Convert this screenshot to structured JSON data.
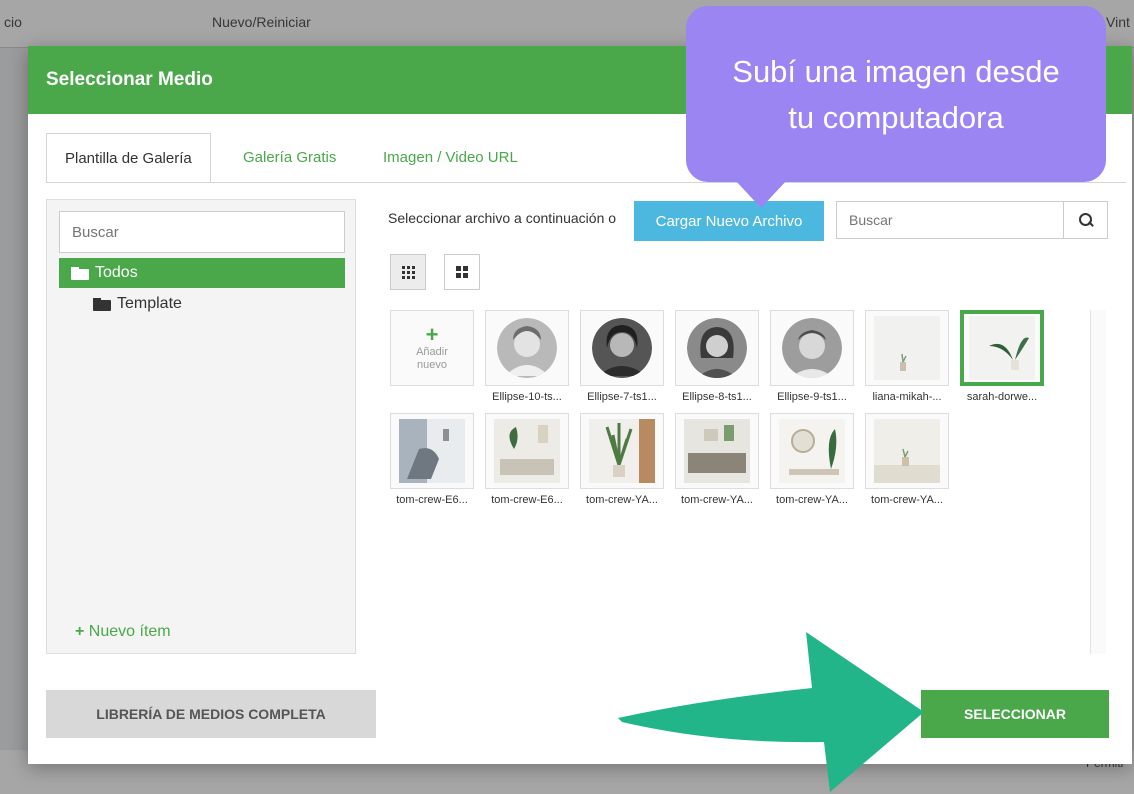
{
  "background": {
    "left_fragment": "cio",
    "toolbar_fragment": "Nuevo/Reiniciar",
    "right_fragment": "Vint",
    "bottom_fragment": "Permiti"
  },
  "modal": {
    "title": "Seleccionar Medio",
    "tabs": [
      {
        "label": "Plantilla de Galería",
        "active": true
      },
      {
        "label": "Galería Gratis",
        "active": false
      },
      {
        "label": "Imagen / Video URL",
        "active": false
      }
    ],
    "left_panel": {
      "search_placeholder": "Buscar",
      "folders": [
        {
          "label": "Todos",
          "active": true
        },
        {
          "label": "Template",
          "active": false
        }
      ],
      "new_item_label": "Nuevo ítem"
    },
    "toolbar": {
      "upload_label": "Seleccionar archivo a continuación o",
      "upload_button": "Cargar Nuevo Archivo",
      "search_placeholder": "Buscar"
    },
    "add_tile": {
      "plus": "+",
      "line1": "Añadir",
      "line2": "nuevo"
    },
    "thumbnails": [
      {
        "name": "Ellipse-10-ts..."
      },
      {
        "name": "Ellipse-7-ts1..."
      },
      {
        "name": "Ellipse-8-ts1..."
      },
      {
        "name": "Ellipse-9-ts1..."
      },
      {
        "name": "liana-mikah-..."
      },
      {
        "name": "sarah-dorwe...",
        "selected": true
      },
      {
        "name": "tom-crew-E6..."
      },
      {
        "name": "tom-crew-E6..."
      },
      {
        "name": "tom-crew-YA..."
      },
      {
        "name": "tom-crew-YA..."
      },
      {
        "name": "tom-crew-YA..."
      },
      {
        "name": "tom-crew-YA..."
      }
    ],
    "footer": {
      "library_button": "LIBRERÍA DE MEDIOS COMPLETA",
      "select_button": "SELECCIONAR"
    }
  },
  "annotation": {
    "callout_line1": "Subí una imagen desde",
    "callout_line2": "tu computadora",
    "callout_color": "#9a85f2",
    "arrow_color": "#23b58a"
  },
  "colors": {
    "brand_green": "#4aa84a",
    "upload_blue": "#4cb8e0"
  }
}
